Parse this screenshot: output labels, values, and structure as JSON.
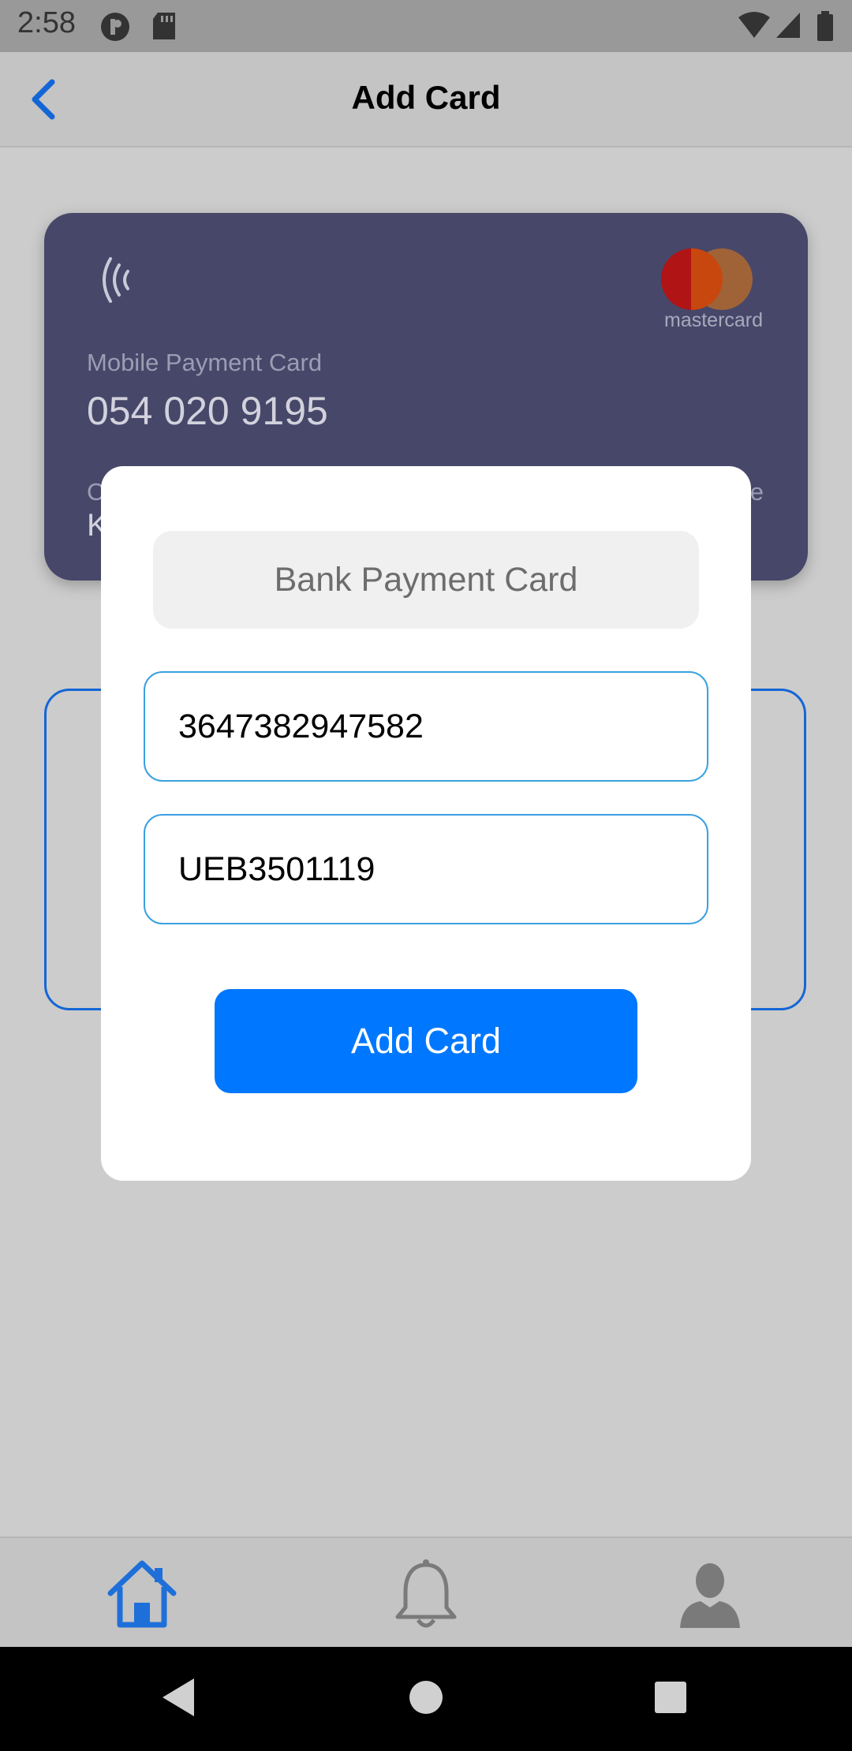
{
  "status_bar": {
    "time": "2:58"
  },
  "header": {
    "title": "Add Card"
  },
  "card": {
    "brand": "mastercard",
    "label": "Mobile Payment Card",
    "number": "054 020 9195",
    "holder_label_partial": "C",
    "holder_name_partial": "K",
    "expiry_label_partial": "e"
  },
  "dialog": {
    "title": "Bank Payment Card",
    "card_number_value": "3647382947582",
    "card_code_value": "UEB3501119",
    "submit_label": "Add Card"
  },
  "bottom_nav": {
    "items": [
      {
        "icon": "home-icon",
        "active": true
      },
      {
        "icon": "bell-icon",
        "active": false
      },
      {
        "icon": "user-icon",
        "active": false
      }
    ],
    "active_color": "#1e6fd9",
    "inactive_color": "#7a7a7a"
  },
  "colors": {
    "accent": "#0077ff",
    "card_bg": "#47476a",
    "back_arrow": "#1366d6"
  }
}
